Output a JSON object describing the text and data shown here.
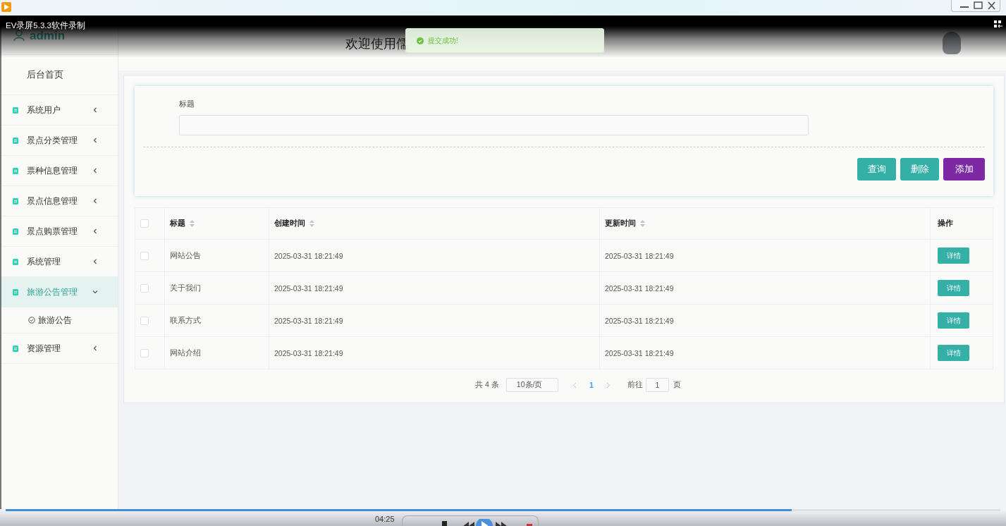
{
  "player": {
    "title": "EV录屏5.3.3软件录制",
    "time": "04:25",
    "progress": {
      "level": 0.79
    }
  },
  "sidebar": {
    "user": "admin",
    "items": [
      {
        "label": "后台首页",
        "kind": "home",
        "selected": false
      },
      {
        "label": "系统用户",
        "kind": "group",
        "expanded": false,
        "selected": false
      },
      {
        "label": "景点分类管理",
        "kind": "group",
        "expanded": false,
        "selected": false
      },
      {
        "label": "票种信息管理",
        "kind": "group",
        "expanded": false,
        "selected": false
      },
      {
        "label": "景点信息管理",
        "kind": "group",
        "expanded": false,
        "selected": false
      },
      {
        "label": "景点购票管理",
        "kind": "group",
        "expanded": false,
        "selected": false
      },
      {
        "label": "系统管理",
        "kind": "group",
        "expanded": false,
        "selected": false
      },
      {
        "label": "旅游公告管理",
        "kind": "group",
        "expanded": true,
        "selected": true,
        "children": [
          {
            "label": "旅游公告"
          }
        ]
      },
      {
        "label": "资源管理",
        "kind": "group",
        "expanded": false,
        "selected": false
      }
    ]
  },
  "header": {
    "title": "欢迎使用儒"
  },
  "toast": {
    "text": "提交成功!"
  },
  "search": {
    "label": "标题"
  },
  "buttons": [
    {
      "label": "查询",
      "kind": "query"
    },
    {
      "label": "删除",
      "kind": "delete"
    },
    {
      "label": "添加",
      "kind": "add"
    }
  ],
  "table": {
    "select_all_checked": false,
    "columns": [
      {
        "label": "标题",
        "sortable": true
      },
      {
        "label": "创建时间",
        "sortable": true
      },
      {
        "label": "更新时间",
        "sortable": true
      },
      {
        "label": "操作",
        "sortable": false
      }
    ],
    "rows": [
      {
        "checked": false,
        "cells": [
          "网站公告",
          "2025-03-31 18:21:49",
          "2025-03-31 18:21:49"
        ],
        "action": "详情"
      },
      {
        "checked": false,
        "cells": [
          "关于我们",
          "2025-03-31 18:21:49",
          "2025-03-31 18:21:49"
        ],
        "action": "详情"
      },
      {
        "checked": false,
        "cells": [
          "联系方式",
          "2025-03-31 18:21:49",
          "2025-03-31 18:21:49"
        ],
        "action": "详情"
      },
      {
        "checked": false,
        "cells": [
          "网站介绍",
          "2025-03-31 18:21:49",
          "2025-03-31 18:21:49"
        ],
        "action": "详情"
      }
    ]
  },
  "pagination": {
    "total": "共 4 条",
    "page_size": "10条/页",
    "pages": [
      {
        "label": "1",
        "selected": true
      }
    ],
    "goto_label": "前往",
    "goto_value": "1",
    "goto_suffix": "页"
  }
}
